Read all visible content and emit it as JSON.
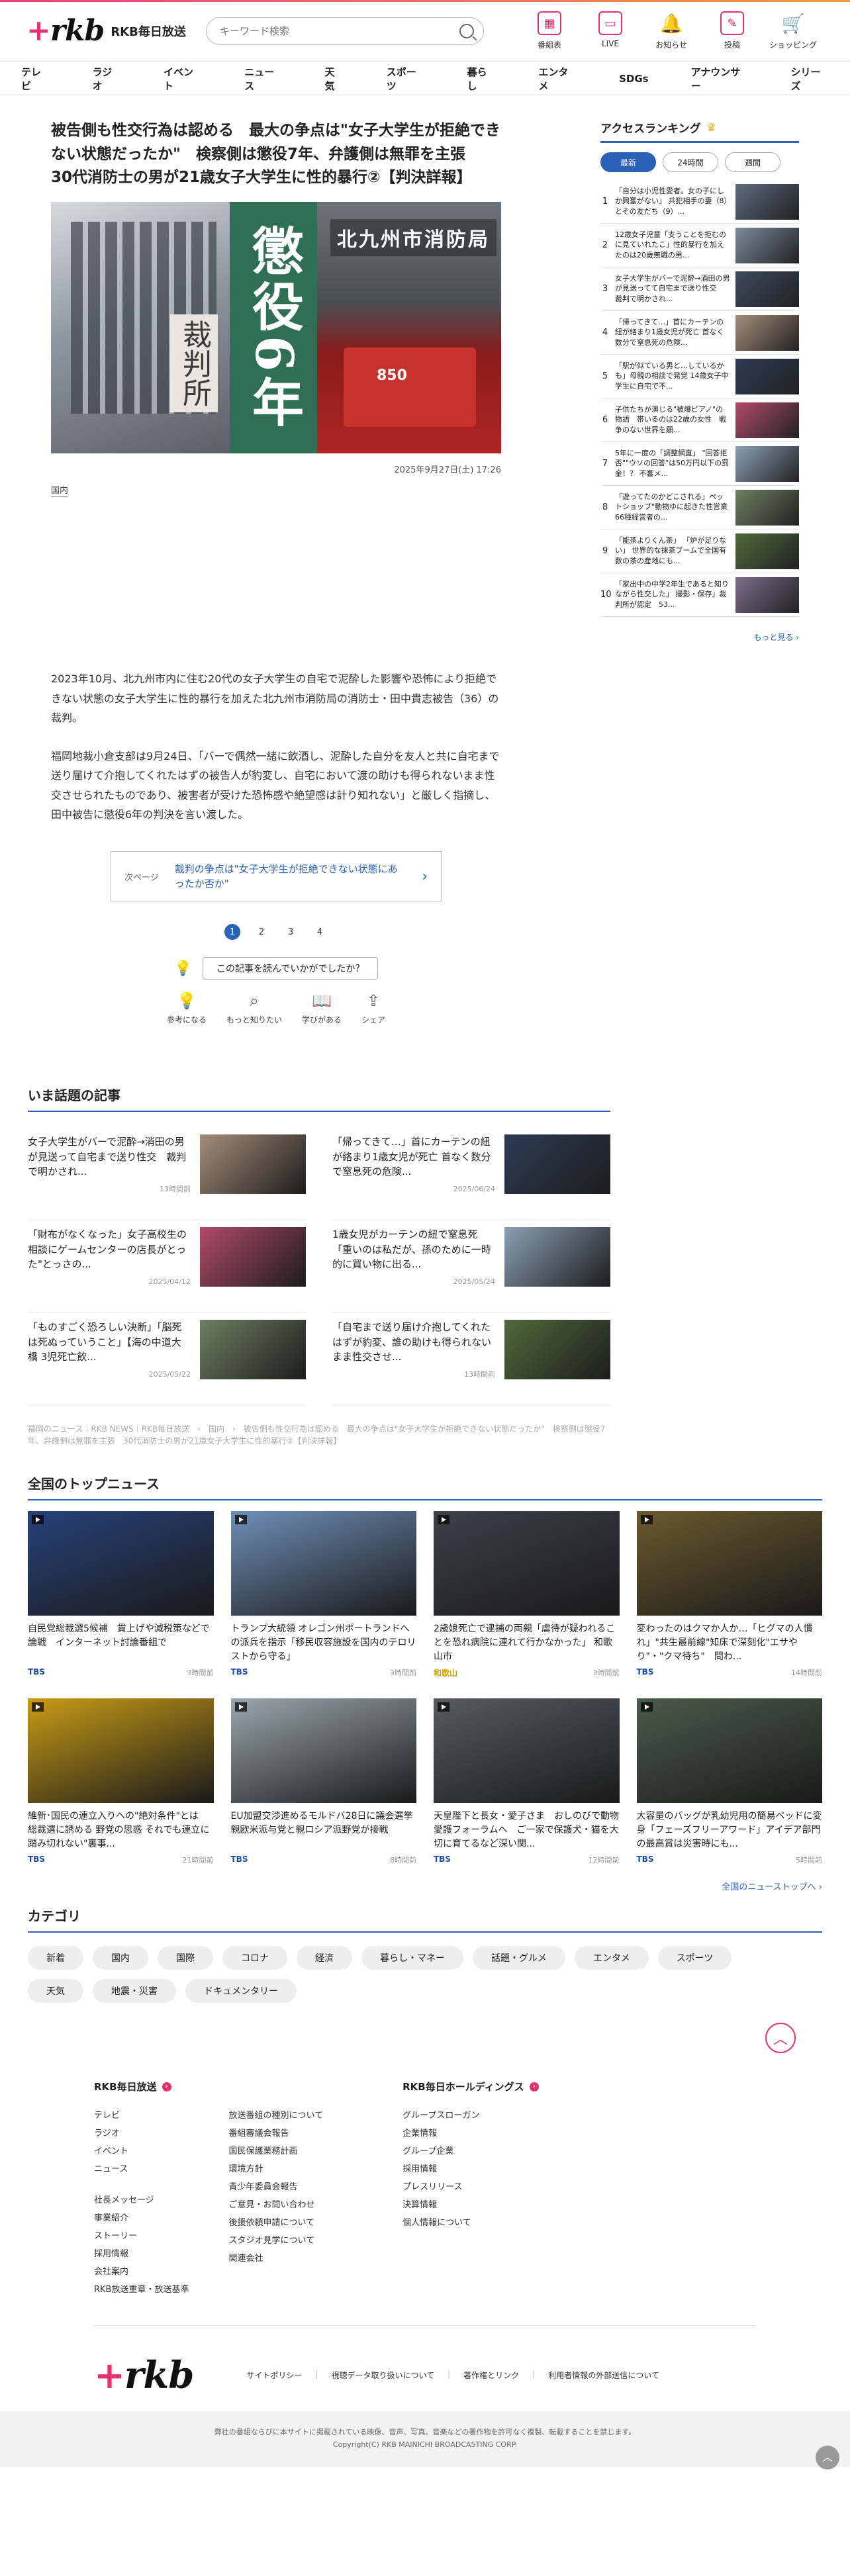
{
  "header": {
    "logo": "rkb",
    "logo_text": "RKB毎日放送",
    "search_placeholder": "キーワード検索",
    "icons": [
      {
        "label": "番組表",
        "icon": "calendar-icon"
      },
      {
        "label": "LIVE",
        "icon": "tv-live-icon"
      },
      {
        "label": "お知らせ",
        "icon": "bell-icon"
      },
      {
        "label": "投稿",
        "icon": "edit-icon"
      },
      {
        "label": "ショッピング",
        "icon": "cart-icon"
      }
    ]
  },
  "nav": [
    "テレビ",
    "ラジオ",
    "イベント",
    "ニュース",
    "天気",
    "スポーツ",
    "暮らし",
    "エンタメ",
    "SDGs",
    "アナウンサー",
    "シリーズ"
  ],
  "article": {
    "title": "被告側も性交行為は認める　最大の争点は\"女子大学生が拒絶できない状態だったか\"　検察側は懲役7年、弁護側は無罪を主張　30代消防士の男が21歳女子大学生に性的暴行②【判決詳報】",
    "hero_banner": "懲役6年",
    "hero_court": "裁判所",
    "hero_fire": "北九州市消防局",
    "date": "2025年9月27日(土) 17:26",
    "category": "国内",
    "paragraphs": [
      "2023年10月、北九州市内に住む20代の女子大学生の自宅で泥酔した影響や恐怖により拒絶できない状態の女子大学生に性的暴行を加えた北九州市消防局の消防士・田中貴志被告（36）の裁判。",
      "福岡地裁小倉支部は9月24日、「バーで偶然一緒に飲酒し、泥酔した自分を友人と共に自宅まで送り届けて介抱してくれたはずの被告人が豹変し、自宅において渡の助けも得られないまま性交させられたものであり、被害者が受けた恐怖感や絶望感は計り知れない」と厳しく指摘し、田中被告に懲役6年の判決を言い渡した。"
    ],
    "next_label": "次ページ",
    "next_title": "裁判の争点は\"女子大学生が拒絶できない状態にあったか否か\"",
    "pages": [
      "1",
      "2",
      "3",
      "4"
    ],
    "feedback_question": "この記事を読んでいかがでしたか？",
    "reactions": [
      "参考になる",
      "もっと知りたい",
      "学びがある",
      "シェア"
    ]
  },
  "ranking": {
    "title": "アクセスランキング",
    "tabs": [
      "最新",
      "24時間",
      "週間"
    ],
    "items": [
      {
        "num": "1",
        "text": "「自分は小児性愛者。女の子にしか興奮がない」 共犯相手の妻（8）とその友だち（9）..."
      },
      {
        "num": "2",
        "text": "12歳女子児童「支うことを拒むのに見ていれたこ」性的暴行を加えたのは20歳無職の男..."
      },
      {
        "num": "3",
        "text": "女子大学生がバーで泥酔→酒田の男が見送ってて自宅まで送り性交　裁判で明かされ..."
      },
      {
        "num": "4",
        "text": "「帰ってきて…」首にカーテンの紐が絡まり1歳女児が死亡 首なく数分で窒息死の危険..."
      },
      {
        "num": "5",
        "text": "「駅が似ている男と…しているかも」母親の相談で発覚 14歳女子中学生に自宅で不..."
      },
      {
        "num": "6",
        "text": "子供たちが演じる\"被爆ピアノ\"の物語　帯いるのは22歳の女性　戦争のない世界を願..."
      },
      {
        "num": "7",
        "text": "5年に一度の「調整網直」 \"回答拒否\"\"ウソの回答\"は50万円以下の罰金！？ 不審メ..."
      },
      {
        "num": "8",
        "text": "「遊ってたのかどこされる」ペットショップ\"動物ゆに起きた性営業　66種経営者の..."
      },
      {
        "num": "9",
        "text": "「能茶よりくん茶」 「炉が足りない」 世界的な抹茶ブームで全国有数の茶の産地にも..."
      },
      {
        "num": "10",
        "text": "「家出中の中学2年生であると知りながら性交した」 撮影・保存」裁判所が認定　53..."
      }
    ],
    "more": "もっと見る ›"
  },
  "trending": {
    "title": "いま話題の記事",
    "items": [
      {
        "text": "女子大学生がバーで泥酔→消田の男が見送って自宅まで送り性交　裁判で明かされ...",
        "date": "13時間前"
      },
      {
        "text": "「帰ってきて…」首にカーテンの紐が絡まり1歳女児が死亡 首なく数分で窒息死の危険...",
        "date": "2025/06/24"
      },
      {
        "text": "「財布がなくなった」女子高校生の相談にゲームセンターの店長がとった\"とっさの...",
        "date": "2025/04/12"
      },
      {
        "text": "1歳女児がカーテンの紐で窒息死「重いのは私だが、孫のために一時的に買い物に出る...",
        "date": "2025/05/24"
      },
      {
        "text": "「ものすごく恐ろしい決断」「脳死は死ぬっていうこと」【海の中道大橋 3児死亡飲...",
        "date": "2025/05/22"
      },
      {
        "text": "「自宅まで送り届け介抱してくれたはずが豹変、誰の助けも得られないまま性交させ...",
        "date": "13時間前"
      }
    ],
    "breadcrumb": "福岡のニュース｜RKB NEWS｜RKB毎日放送　›　国内　›　被告側も性交行為は認める　最大の争点は\"女子大学生が拒絶できない状態だったか\"　検察側は懲役7年、弁護側は無罪を主張　30代消防士の男が21歳女子大学生に性的暴行②【判決詳報】"
  },
  "top_news": {
    "title": "全国のトップニュース",
    "items": [
      {
        "title": "自民党総裁選5候補　貫上げや減税策などで論戦　インターネット討論番組で",
        "source": "TBS",
        "ago": "3時間前"
      },
      {
        "title": "トランプ大統領 オレゴン州ポートランドへの派兵を指示「移民収容施設を国内のテロリストから守る」",
        "source": "TBS",
        "ago": "3時間前"
      },
      {
        "title": "2歳娘死亡で逮捕の両親「虐待が疑われることを恐れ病院に連れて行かなかった」 和歌山市",
        "source": "和歌山",
        "ago": "3時間前"
      },
      {
        "title": "変わったのはクマか人か…「ヒグマの人慣れ」\"共生最前線\"知床で深刻化\"エサやり\"・\"クマ待ち\"　問わ...",
        "source": "TBS",
        "ago": "14時間前"
      },
      {
        "title": "維新･国民の連立入りへの\"絶対条件\"とは　総裁選に誘める 野党の思惑 それでも連立に踏み切れない\"裏事...",
        "source": "TBS",
        "ago": "21時間前"
      },
      {
        "title": "EU加盟交渉進めるモルドバ28日に議会選挙　親欧米派与党と親ロシア派野党が接戦",
        "source": "TBS",
        "ago": "8時間前"
      },
      {
        "title": "天皇陛下と長女・愛子さま　おしのびで動物愛護フォーラムへ　ご一家で保護犬・猫を大切に育てるなど深い関...",
        "source": "TBS",
        "ago": "12時間前"
      },
      {
        "title": "大容量のバッグが乳幼児用の簡易ベッドに変身「フェーズフリーアワード」アイデア部門の最高賞は災害時にも...",
        "source": "TBS",
        "ago": "5時間前"
      }
    ],
    "more": "全国のニューストップへ ›"
  },
  "categories": {
    "title": "カテゴリ",
    "items": [
      "新着",
      "国内",
      "国際",
      "コロナ",
      "経済",
      "暮らし・マネー",
      "話題・グルメ",
      "エンタメ",
      "スポーツ",
      "天気",
      "地震・災害",
      "ドキュメンタリー"
    ]
  },
  "footer": {
    "col1_title": "RKB毎日放送",
    "col1_a": [
      "テレビ",
      "ラジオ",
      "イベント",
      "ニュース"
    ],
    "col1_a2": [
      "社長メッセージ",
      "事業紹介",
      "ストーリー",
      "採用情報",
      "会社案内",
      "RKB放送重章・放送基準"
    ],
    "col1_b": [
      "放送番組の種別について",
      "番組審議会報告",
      "国民保護業務計画",
      "環境方針",
      "青少年委員会報告",
      "ご意見・お問い合わせ",
      "後援依頼申請について",
      "スタジオ見学について",
      "関連会社"
    ],
    "col2_title": "RKB毎日ホールディングス",
    "col2": [
      "グループスローガン",
      "企業情報",
      "グループ企業",
      "採用情報",
      "プレスリリース",
      "決算情報",
      "個人情報について"
    ],
    "legal": [
      "サイトポリシー",
      "視聴データ取り扱いについて",
      "著作権とリンク",
      "利用者情報の外部送信について"
    ],
    "copyright1": "弊社の番組ならびに本サイトに掲載されている映像、音声、写真、音楽などの著作物を許可なく複製、転載することを禁じます。",
    "copyright2": "Copyright(C) RKB MAINICHI BROADCASTING CORP."
  }
}
